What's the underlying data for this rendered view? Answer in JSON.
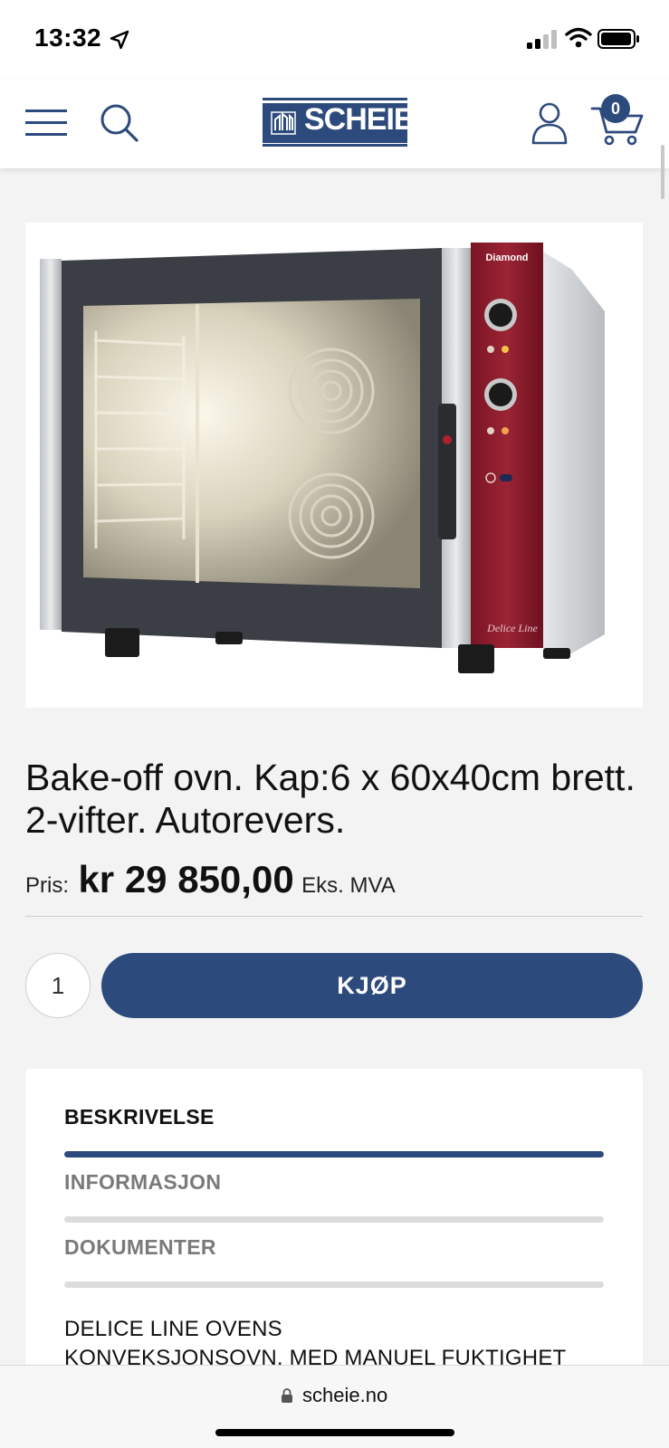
{
  "status_bar": {
    "time": "13:32"
  },
  "header": {
    "logo_text": "SCHEIE",
    "cart_count": "0"
  },
  "product": {
    "title": "Bake-off ovn. Kap:6 x 60x40cm brett. 2-vifter. Autorevers.",
    "image_panel_text": "Diamond",
    "image_signature": "Delice Line",
    "price_label": "Pris:",
    "price_value": "kr 29 850,00",
    "price_suffix": "Eks. MVA",
    "quantity": "1",
    "buy_label": "KJØP"
  },
  "tabs": [
    {
      "label": "BESKRIVELSE",
      "active": true
    },
    {
      "label": "INFORMASJON",
      "active": false
    },
    {
      "label": "DOKUMENTER",
      "active": false
    }
  ],
  "description": {
    "line1": "DELICE LINE OVENS",
    "line2": "KONVEKSJONSOVN. MED MANUEL FUKTIGHET"
  },
  "browser": {
    "url": "scheie.no"
  },
  "colors": {
    "brand": "#2c4a7c",
    "tab_inactive_bar": "#dcdcdc",
    "tab_inactive_text": "#7a7a7a",
    "oven_panel_red": "#8e1c2c"
  }
}
